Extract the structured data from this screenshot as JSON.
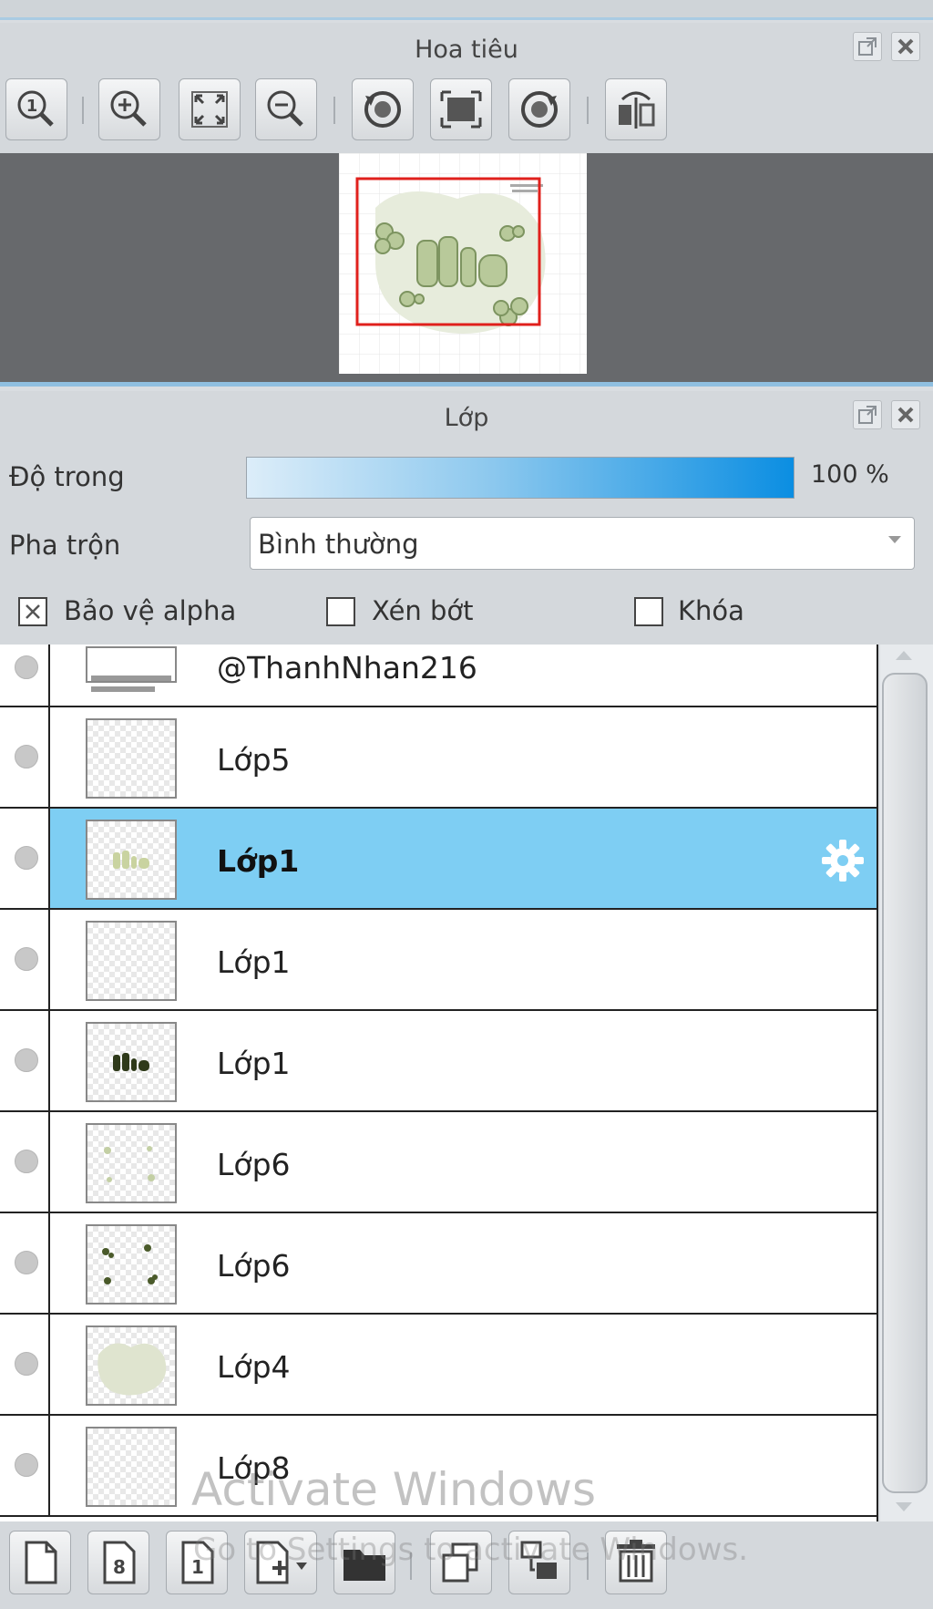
{
  "navigator": {
    "title": "Hoa tiêu",
    "tools": [
      "zoom-actual-icon",
      "zoom-in-icon",
      "fit-screen-icon",
      "zoom-out-icon",
      "rotate-left-icon",
      "reset-view-icon",
      "rotate-right-icon",
      "flip-horizontal-icon"
    ]
  },
  "layers_panel": {
    "title": "Lớp",
    "opacity_label": "Độ trong",
    "opacity_value": "100 %",
    "opacity_level": 1.0,
    "blend_label": "Pha trộn",
    "blend_value": "Bình thường",
    "checkboxes": [
      {
        "label": "Bảo vệ alpha",
        "checked": true
      },
      {
        "label": "Xén bớt",
        "checked": false
      },
      {
        "label": "Khóa",
        "checked": false
      }
    ],
    "layers": [
      {
        "name": "@ThanhNhan216",
        "thumb": "text",
        "selected": false
      },
      {
        "name": "Lớp5",
        "thumb": "empty",
        "selected": false
      },
      {
        "name": "Lớp1",
        "thumb": "text-light",
        "selected": true
      },
      {
        "name": "Lớp1",
        "thumb": "empty",
        "selected": false
      },
      {
        "name": "Lớp1",
        "thumb": "text-dark",
        "selected": false
      },
      {
        "name": "Lớp6",
        "thumb": "dots-light",
        "selected": false
      },
      {
        "name": "Lớp6",
        "thumb": "dots-dark",
        "selected": false
      },
      {
        "name": "Lớp4",
        "thumb": "blob",
        "selected": false
      },
      {
        "name": "Lớp8",
        "thumb": "empty",
        "selected": false
      }
    ],
    "bottom_tools": [
      "new-layer-icon",
      "new-8bit-layer-icon",
      "new-1bit-layer-icon",
      "add-layer-menu-icon",
      "new-folder-icon",
      "duplicate-layer-icon",
      "merge-down-icon",
      "delete-layer-icon"
    ]
  },
  "watermark": {
    "line1": "Activate Windows",
    "line2": "Go to Settings to activate Windows."
  },
  "colors": {
    "accent_blue": "#0b8ee2",
    "selected_row": "#7ecef3",
    "preview_bg": "#67696c",
    "frame_red": "#e0201c"
  }
}
